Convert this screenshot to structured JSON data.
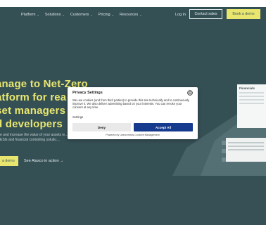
{
  "nav": {
    "items": [
      {
        "label": "Platform"
      },
      {
        "label": "Solutions"
      },
      {
        "label": "Customers"
      },
      {
        "label": "Pricing"
      },
      {
        "label": "Resources"
      }
    ],
    "login_label": "Log in",
    "contact_label": "Contact sales",
    "demo_label": "Book a demo"
  },
  "hero": {
    "title_lines": [
      "anage to Net-Zero",
      "atform for rea",
      "set managers",
      "d developers"
    ],
    "subtitle": "e and increase the value of your assets w… and ESG and financial controlling solutio…",
    "cta_label": "a demo",
    "link_label": "See Alasco in action →"
  },
  "cards": {
    "card1_heading": "Financials"
  },
  "consent": {
    "title": "Privacy Settings",
    "body": "We use cookies (and from third parties) to provide this site technically and to continuously improve it. We also deliver advertising based on your interests. You can revoke your consent at any time.",
    "settings_label": "Settings",
    "deny_label": "Deny",
    "accept_label": "Accept All",
    "powered_by": "Powered by Usercentrics Consent Management"
  },
  "colors": {
    "background": "#18363c",
    "accent": "#e5e35a",
    "accept_button": "#163a8d"
  }
}
